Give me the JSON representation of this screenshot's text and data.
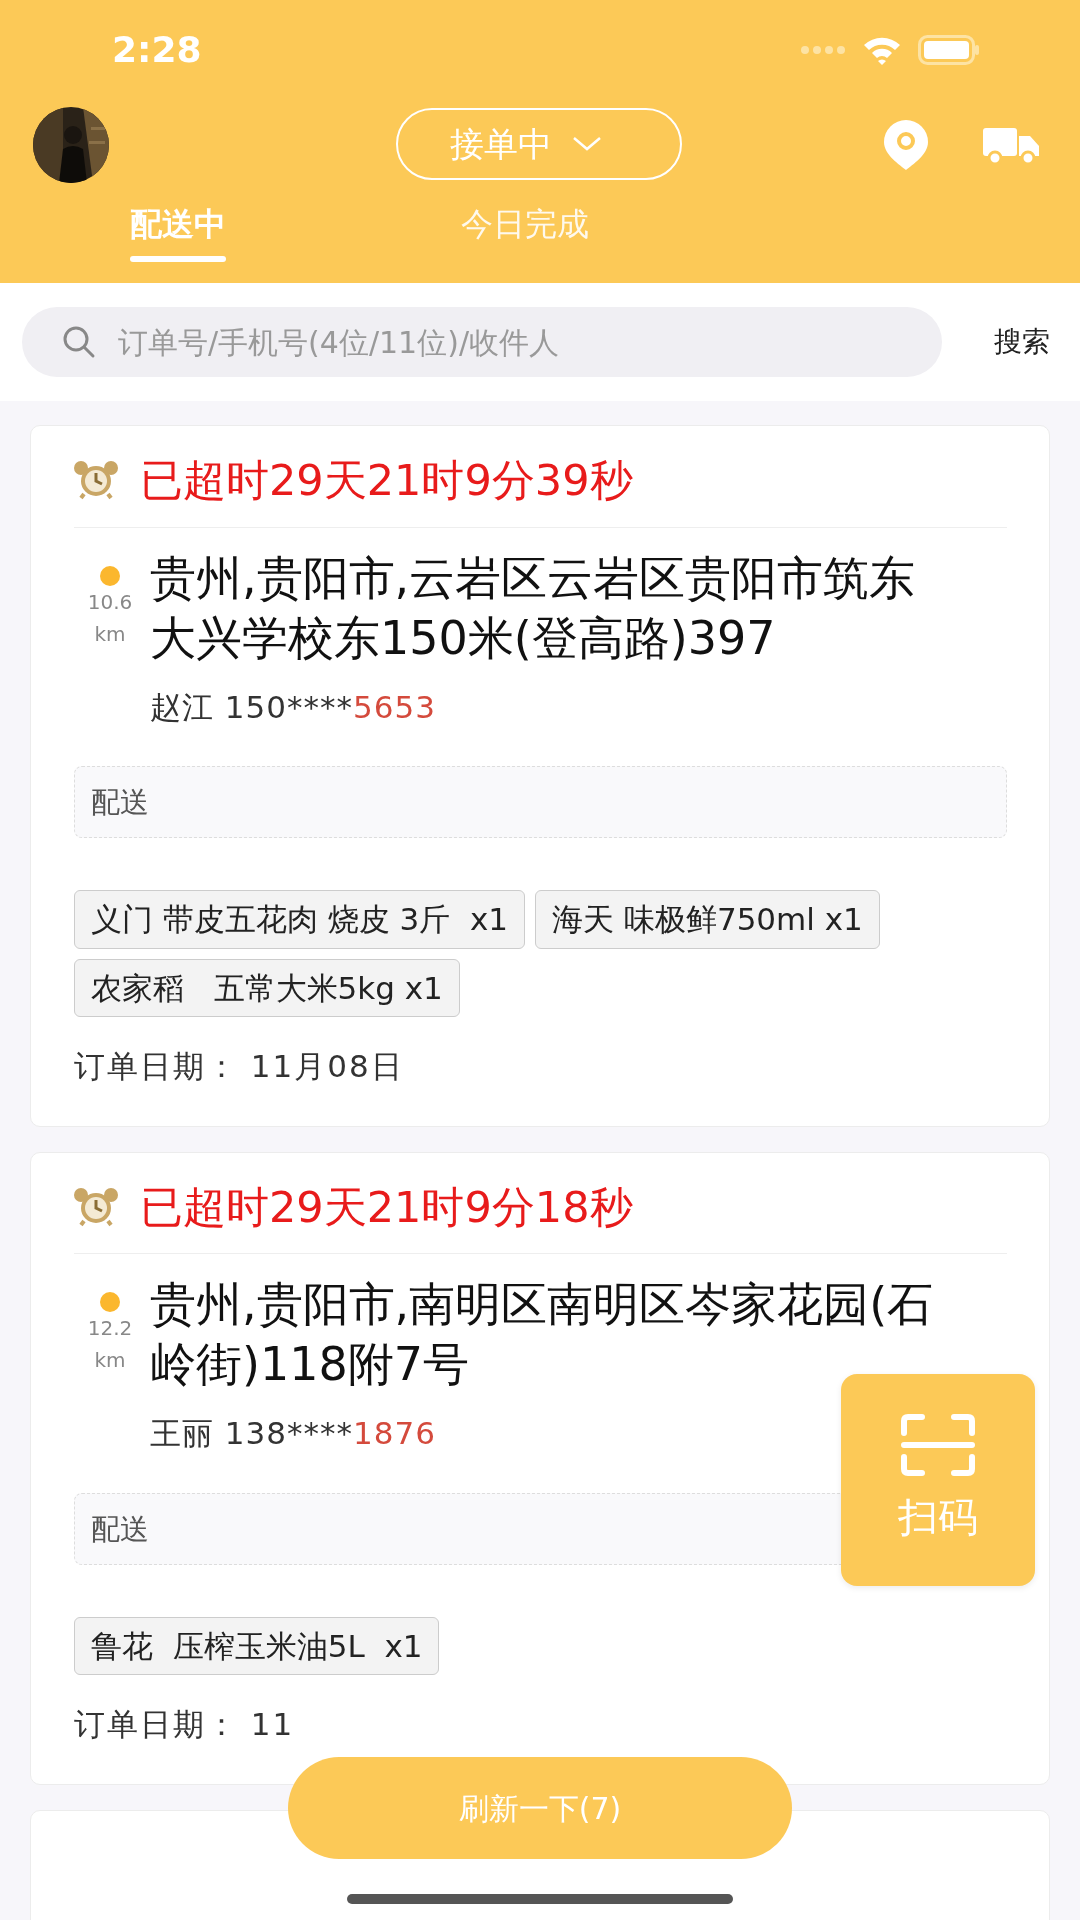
{
  "status_bar": {
    "time": "2:28"
  },
  "header": {
    "status_toggle": "接单中",
    "tabs": [
      {
        "label": "配送中",
        "selected": true
      },
      {
        "label": "今日完成",
        "selected": false
      }
    ]
  },
  "search": {
    "placeholder": "订单号/手机号(4位/11位)/收件人",
    "button": "搜索"
  },
  "orders": [
    {
      "overdue": "已超时29天21时9分39秒",
      "distance": "10.6",
      "distance_unit": "km",
      "address": "贵州,贵阳市,云岩区云岩区贵阳市筑东大兴学校东150米(登高路)397",
      "contact_name": "赵江",
      "phone_masked": "150****",
      "phone_tail": "5653",
      "note": "配送",
      "items": [
        "义门 带皮五花肉 烧皮 3斤  x1",
        "海天 味极鲜750ml x1",
        "农家稻   五常大米5kg x1"
      ],
      "date_label": "订单日期：",
      "date": "11月08日"
    },
    {
      "overdue": "已超时29天21时9分18秒",
      "distance": "12.2",
      "distance_unit": "km",
      "address": "贵州,贵阳市,南明区南明区岑家花园(石岭街)118附7号",
      "contact_name": "王丽",
      "phone_masked": "138****",
      "phone_tail": "1876",
      "note": "配送",
      "items": [
        "鲁花  压榨玉米油5L  x1"
      ],
      "date_label": "订单日期：",
      "date": "11"
    }
  ],
  "scan_button": "扫码",
  "refresh_button": "刷新一下(7)"
}
